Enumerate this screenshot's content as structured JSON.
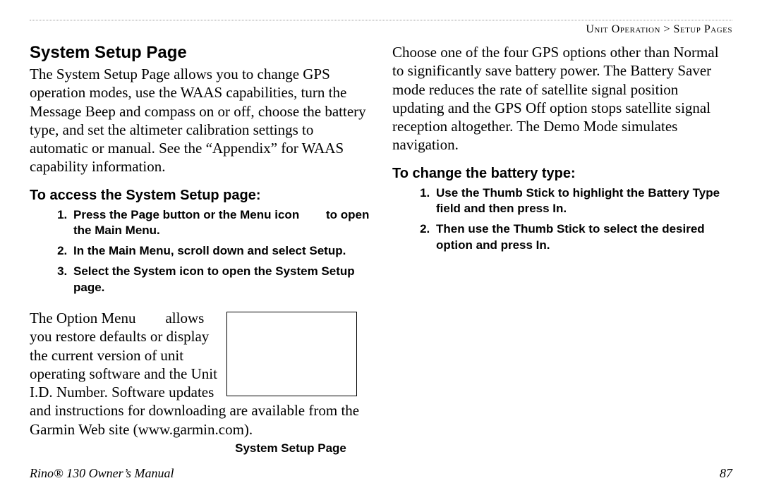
{
  "breadcrumb": "Unit Operation > Setup Pages",
  "left": {
    "title": "System Setup Page",
    "intro": "The System Setup Page allows you to change GPS operation modes, use the WAAS capabilities, turn the Message Beep and compass on or off, choose the battery type, and set the altimeter calibration settings to automatic or manual. See the “Appendix” for WAAS capability information.",
    "sub1": "To access the System Setup page:",
    "steps": [
      "Press the Page button or the Menu icon        to open the Main Menu.",
      "In the Main Menu, scroll down and select Setup.",
      "Select the System icon to open the System Setup page."
    ],
    "options_text": "The Option Menu        allows you restore defaults or display the current version of unit operating software and the Unit I.D. Number. Software updates and instructions for downloading are available from the Garmin Web site (www.garmin.com).",
    "figure_caption": "System Setup Page"
  },
  "right": {
    "gps_text": "Choose one of the four GPS options other than Normal to significantly save battery power. The Battery Saver mode reduces the rate of satellite signal position updating and the GPS Off option stops satellite signal reception altogether. The Demo Mode simulates navigation.",
    "sub1": "To change the battery type:",
    "steps": [
      "Use the Thumb Stick to highlight the Battery Type field and then press In.",
      "Then use the Thumb Stick to select the desired option and press In."
    ]
  },
  "footer": {
    "manual": "Rino® 130 Owner’s Manual",
    "page": "87"
  }
}
